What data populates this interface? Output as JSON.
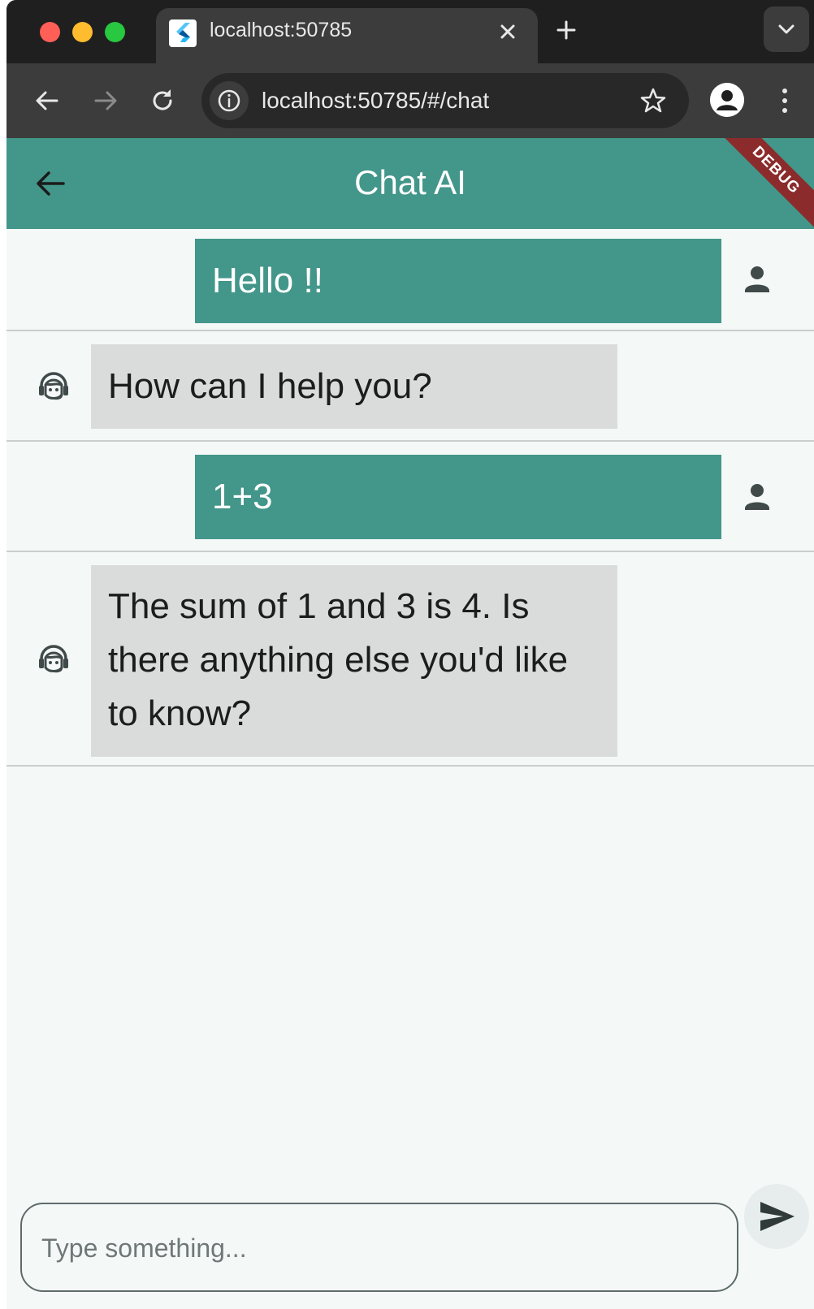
{
  "browser": {
    "tab_title": "localhost:50785",
    "url": "localhost:50785/#/chat"
  },
  "app": {
    "title": "Chat AI",
    "debug_banner": "DEBUG",
    "accent_color": "#43968a"
  },
  "messages": [
    {
      "sender": "user",
      "text": "Hello !!"
    },
    {
      "sender": "ai",
      "text": "How can I help you?"
    },
    {
      "sender": "user",
      "text": "1+3"
    },
    {
      "sender": "ai",
      "text": "The sum of 1 and 3 is 4. Is there anything else you'd like to know?"
    }
  ],
  "input": {
    "placeholder": "Type something..."
  },
  "icons": {
    "user": "person-icon",
    "ai": "support-agent-icon",
    "send": "send-icon",
    "back": "arrow-back-icon"
  }
}
